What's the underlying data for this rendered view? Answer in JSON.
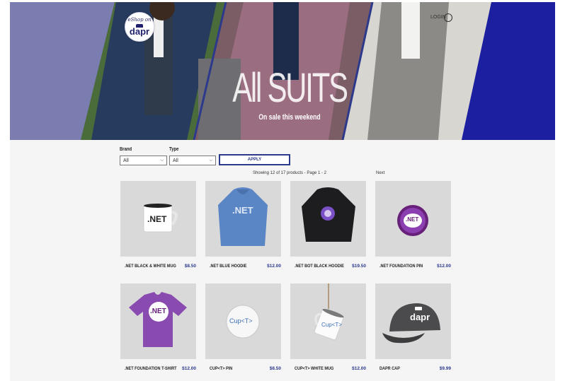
{
  "hero": {
    "title": "All SUITS",
    "subtitle": "On sale this weekend",
    "logo_top": "eShop on",
    "logo_word": "dapr",
    "cart_label": "LOGIN"
  },
  "filters": {
    "brand_label": "Brand",
    "brand_value": "All",
    "type_label": "Type",
    "type_value": "All",
    "apply_label": "APPLY"
  },
  "paging": {
    "summary": "Showing 12 of 17 products - Page 1 - 2",
    "next_label": "Next"
  },
  "products": [
    {
      "name": ".NET BLACK & WHITE MUG",
      "price": "$8.50",
      "image_text": ".NET",
      "icon": "mug-icon"
    },
    {
      "name": ".NET BLUE HOODIE",
      "price": "$12.00",
      "image_text": ".NET",
      "icon": "hoodie-icon"
    },
    {
      "name": ".NET BOT BLACK HOODIE",
      "price": "$19.50",
      "image_text": "",
      "icon": "hoodie-icon"
    },
    {
      "name": ".NET FOUNDATION PIN",
      "price": "$12.00",
      "image_text": ".NET",
      "icon": "pin-icon"
    },
    {
      "name": ".NET FOUNDATION T-SHIRT",
      "price": "$12.00",
      "image_text": ".NET",
      "icon": "tshirt-icon"
    },
    {
      "name": "CUP<T> PIN",
      "price": "$8.50",
      "image_text": "Cup<T>",
      "icon": "pin-icon"
    },
    {
      "name": "CUP<T> WHITE MUG",
      "price": "$12.00",
      "image_text": "Cup<T>",
      "icon": "mug-icon"
    },
    {
      "name": "DAPR CAP",
      "price": "$9.99",
      "image_text": "dapr",
      "icon": "cap-icon"
    }
  ],
  "colors": {
    "accent": "#2d3a8c",
    "hero_left": "#7b7cb0",
    "hero_right": "#1b1fa0",
    "thumb_bg": "#d9d9d9"
  }
}
